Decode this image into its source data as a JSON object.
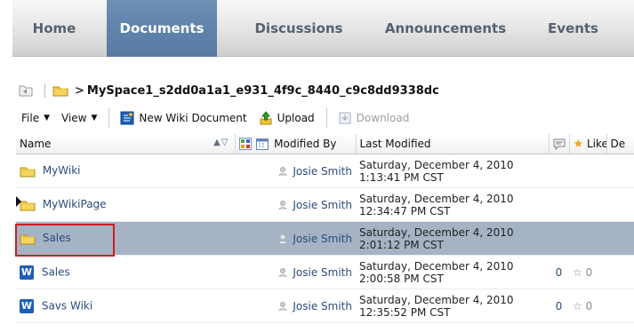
{
  "nav": {
    "tabs": [
      {
        "label": "Home",
        "active": false
      },
      {
        "label": "Documents",
        "active": true
      },
      {
        "label": "Discussions",
        "active": false
      },
      {
        "label": "Announcements",
        "active": false
      },
      {
        "label": "Events",
        "active": false
      }
    ]
  },
  "breadcrumb": {
    "path": "MySpace1_s2dd0a1a1_e931_4f9c_8440_c9c8dd9338dc"
  },
  "toolbar": {
    "file": "File",
    "view": "View",
    "new_wiki": "New Wiki Document",
    "upload": "Upload",
    "download": "Download"
  },
  "table": {
    "columns": {
      "name": "Name",
      "modified_by": "Modified By",
      "last_modified": "Last Modified",
      "like": "Like",
      "extra": "De"
    },
    "rows": [
      {
        "name": "MyWiki",
        "type": "folder",
        "modified_by": "Josie Smith",
        "last_modified_1": "Saturday, December 4, 2010",
        "last_modified_2": "1:13:41 PM CST",
        "comments": "",
        "likes": ""
      },
      {
        "name": "MyWikiPage",
        "type": "folder",
        "modified_by": "Josie Smith",
        "last_modified_1": "Saturday, December 4, 2010",
        "last_modified_2": "12:34:47 PM CST",
        "comments": "",
        "likes": ""
      },
      {
        "name": "Sales",
        "type": "folder",
        "modified_by": "Josie Smith",
        "last_modified_1": "Saturday, December 4, 2010",
        "last_modified_2": "2:01:12 PM CST",
        "comments": "",
        "likes": "",
        "selected": true
      },
      {
        "name": "Sales",
        "type": "wiki",
        "modified_by": "Josie Smith",
        "last_modified_1": "Saturday, December 4, 2010",
        "last_modified_2": "2:00:58 PM CST",
        "comments": "0",
        "likes": "0"
      },
      {
        "name": "Savs Wiki",
        "type": "wiki",
        "modified_by": "Josie Smith",
        "last_modified_1": "Saturday, December 4, 2010",
        "last_modified_2": "12:35:52 PM CST",
        "comments": "0",
        "likes": "0"
      }
    ]
  },
  "icons": {
    "folder": "folder-icon",
    "wiki": "wiki-document-icon",
    "person": "person-icon",
    "star": "star-icon"
  },
  "colors": {
    "active_tab": "#5f82ab",
    "selected_row": "#a5b3c5",
    "highlight_box": "#cc1f1f"
  }
}
